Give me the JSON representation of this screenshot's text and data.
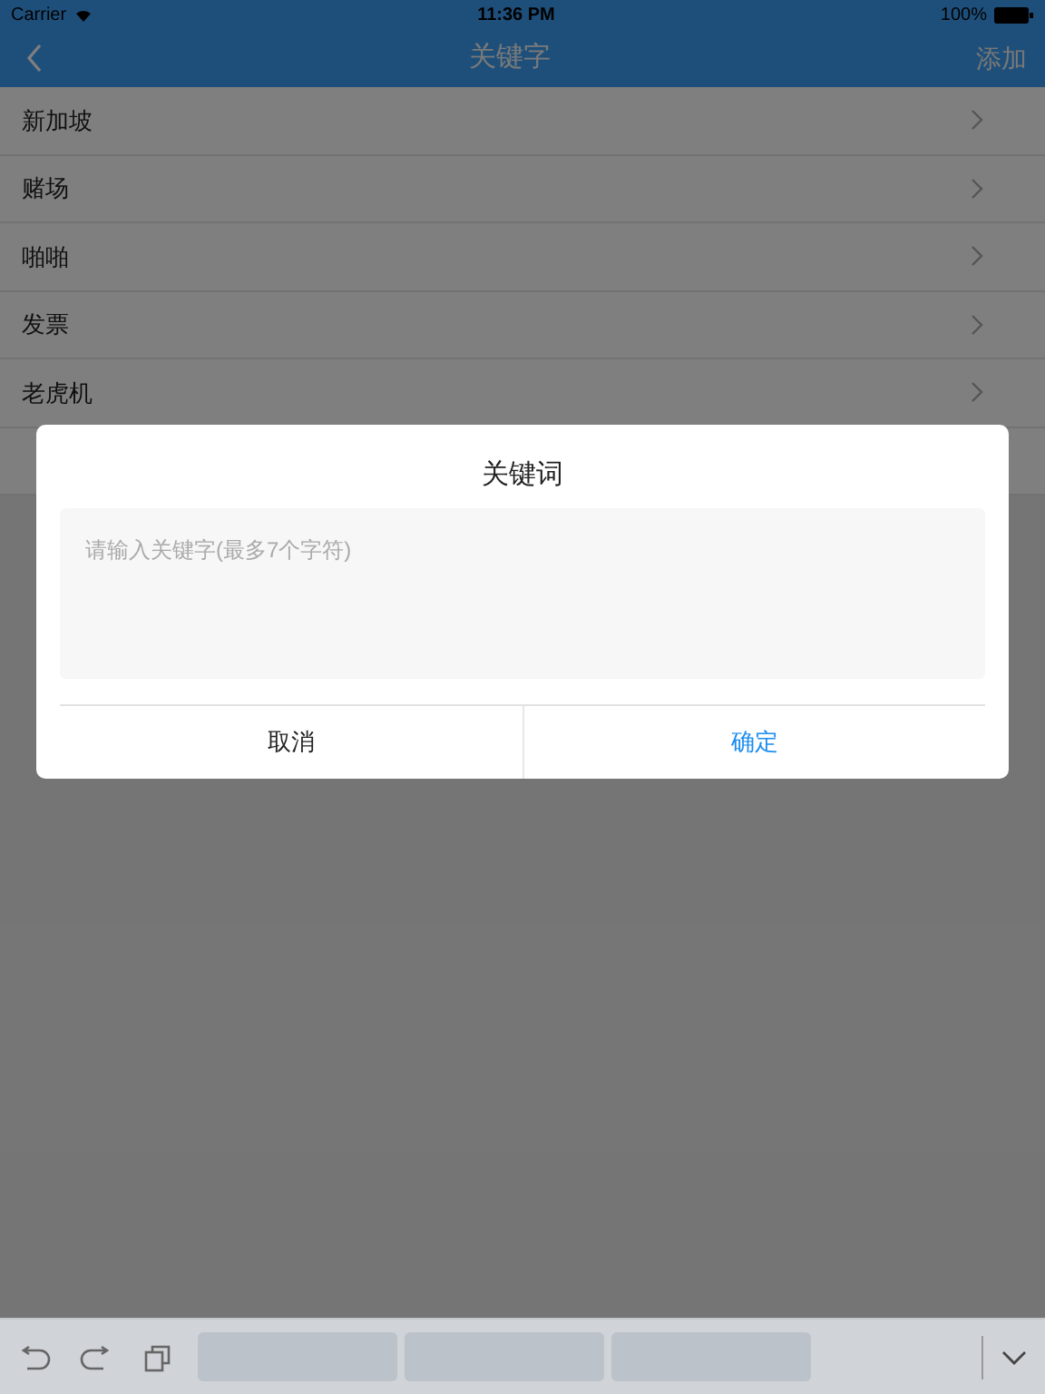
{
  "status_bar": {
    "carrier": "Carrier",
    "time": "11:36 PM",
    "battery": "100%"
  },
  "nav": {
    "title": "关键字",
    "action": "添加"
  },
  "items": [
    {
      "label": "新加坡"
    },
    {
      "label": "赌场"
    },
    {
      "label": "啪啪"
    },
    {
      "label": "发票"
    },
    {
      "label": "老虎机"
    }
  ],
  "dialog": {
    "title": "关键词",
    "placeholder": "请输入关键字(最多7个字符)",
    "buttons": [
      {
        "label": "取消",
        "primary": false
      },
      {
        "label": "确定",
        "primary": true
      }
    ]
  }
}
